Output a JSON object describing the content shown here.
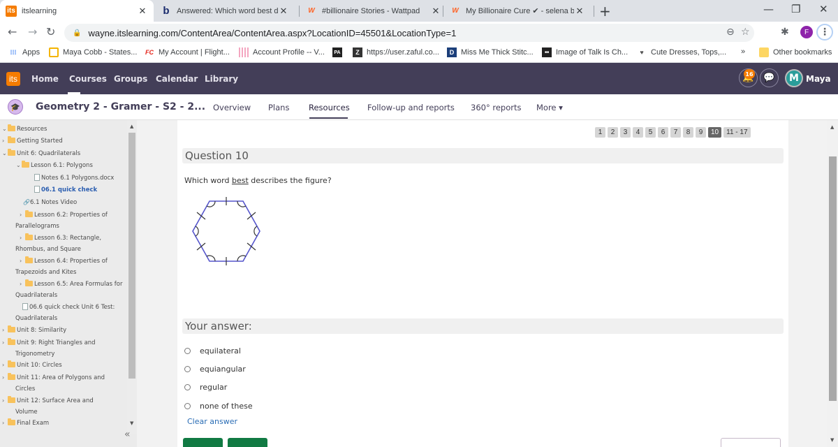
{
  "browser": {
    "tabs": [
      {
        "title": "itslearning",
        "favicon": "its",
        "active": true
      },
      {
        "title": "Answered: Which word best desc",
        "favicon": "b",
        "active": false
      },
      {
        "title": "#billionaire Stories - Wattpad",
        "favicon": "W",
        "active": false
      },
      {
        "title": "My Billionaire Cure ✔ - selena b",
        "favicon": "W",
        "active": false
      }
    ],
    "url": "wayne.itslearning.com/ContentArea/ContentArea.aspx?LocationID=45501&LocationType=1",
    "bookmarks": [
      {
        "label": "Apps",
        "icon": "apps-grid-icon"
      },
      {
        "label": "Maya Cobb - States...",
        "icon": "slides-icon"
      },
      {
        "label": "My Account | Flight...",
        "icon": "fc-icon"
      },
      {
        "label": "Account Profile -- V...",
        "icon": "stripes-icon"
      },
      {
        "label": "",
        "icon": "pa-icon"
      },
      {
        "label": "https://user.zaful.co...",
        "icon": "z-icon"
      },
      {
        "label": "Miss Me Thick Stitc...",
        "icon": "d-icon"
      },
      {
        "label": "Image of Talk Is Ch...",
        "icon": "image-icon"
      },
      {
        "label": "Cute Dresses, Tops,...",
        "icon": "v-icon"
      }
    ],
    "more_bookmarks": "»",
    "other_bookmarks": "Other bookmarks",
    "profile_initial": "F"
  },
  "app": {
    "logo": "its",
    "nav": [
      "Home",
      "Courses",
      "Groups",
      "Calendar",
      "Library"
    ],
    "notification_count": "16",
    "user_name": "Maya",
    "avatar_letter": "M"
  },
  "course": {
    "title": "Geometry 2 - Gramer - S2 - 2...",
    "tabs": [
      "Overview",
      "Plans",
      "Resources",
      "Follow-up and reports",
      "360° reports",
      "More ▾"
    ],
    "active_tab": "Resources"
  },
  "sidebar": {
    "items": [
      {
        "label": "Resources",
        "arrow": "v",
        "type": "folder"
      },
      {
        "label": "Getting Started",
        "arrow": ">",
        "type": "folder"
      },
      {
        "label": "Unit 6: Quadrilaterals",
        "arrow": "v",
        "type": "folder"
      },
      {
        "label": "Lesson 6.1: Polygons",
        "arrow": "v",
        "type": "folder"
      },
      {
        "label": "Notes 6.1 Polygons.docx",
        "arrow": "",
        "type": "doc"
      },
      {
        "label": "06.1 quick check",
        "arrow": "",
        "type": "test",
        "current": true
      },
      {
        "label": "6.1 Notes Video",
        "arrow": "",
        "type": "link"
      },
      {
        "label": "Lesson 6.2: Properties of",
        "label2": "Parallelograms",
        "arrow": ">",
        "type": "folder"
      },
      {
        "label": "Lesson 6.3: Rectangle,",
        "label2": "Rhombus, and Square",
        "arrow": ">",
        "type": "folder"
      },
      {
        "label": "Lesson 6.4: Properties of",
        "label2": "Trapezoids and Kites",
        "arrow": ">",
        "type": "folder"
      },
      {
        "label": "Lesson 6.5: Area Formulas for",
        "label2": "Quadrilaterals",
        "arrow": ">",
        "type": "folder"
      },
      {
        "label": "06.6 quick check Unit 6 Test:",
        "label2": "Quadrilaterals",
        "arrow": "",
        "type": "test"
      },
      {
        "label": "Unit 8: Similarity",
        "arrow": ">",
        "type": "folder"
      },
      {
        "label": "Unit 9: Right Triangles and",
        "label2": "Trigonometry",
        "arrow": ">",
        "type": "folder"
      },
      {
        "label": "Unit 10: Circles",
        "arrow": ">",
        "type": "folder"
      },
      {
        "label": "Unit 11: Area of Polygons and",
        "label2": "Circles",
        "arrow": ">",
        "type": "folder"
      },
      {
        "label": "Unit 12: Surface Area and",
        "label2": "Volume",
        "arrow": ">",
        "type": "folder"
      },
      {
        "label": "Final Exam",
        "arrow": ">",
        "type": "folder"
      }
    ],
    "collapse_label": "«"
  },
  "quiz": {
    "pages": [
      "1",
      "2",
      "3",
      "4",
      "5",
      "6",
      "7",
      "8",
      "9",
      "10",
      "11 - 17"
    ],
    "current_page": "10",
    "question_heading": "Question 10",
    "question_pre": "Which word ",
    "question_emph": "best",
    "question_post": " describes the figure?",
    "figure": {
      "shape": "hexagon",
      "congruent_sides": 6,
      "congruent_angles": 6,
      "stroke": "#5555cc"
    },
    "answer_heading": "Your answer:",
    "options": [
      "equilateral",
      "equiangular",
      "regular",
      "none of these"
    ],
    "selected": null,
    "clear_label": "Clear answer"
  }
}
